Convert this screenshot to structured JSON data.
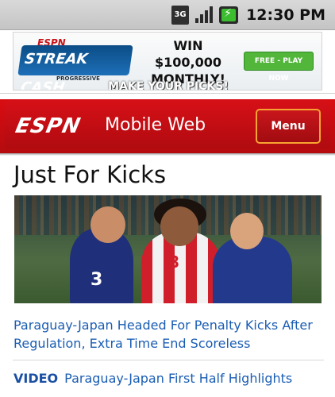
{
  "status_bar": {
    "network_label": "3G",
    "time": "12:30 PM",
    "icons": [
      "network-3g-icon",
      "signal-strength-icon",
      "battery-charging-icon"
    ]
  },
  "ad": {
    "brand_small": "ESPN",
    "logo_text": "STREAK CASH",
    "sponsor": "PROGRESSIVE",
    "headline_line1": "WIN $100,000",
    "headline_line2": "MONTHLY!",
    "cta": "FREE - PLAY NOW",
    "subline": "MAKE YOUR PICKS!"
  },
  "header": {
    "logo": "ESPN",
    "site_name": "Mobile Web",
    "menu_label": "Menu",
    "colors": {
      "header_red": "#c8101a",
      "menu_border": "#f7a432"
    }
  },
  "main": {
    "section_title": "Just For Kicks",
    "hero_image": {
      "description_icon": "soccer-match-photo",
      "jersey_numbers": [
        "3",
        "8"
      ]
    },
    "headline": "Paraguay-Japan Headed For Penalty Kicks After Regulation, Extra Time End Scoreless",
    "video_item": {
      "tag": "VIDEO",
      "title": "Paraguay-Japan First Half Highlights"
    },
    "link_color": "#1a5db3"
  }
}
